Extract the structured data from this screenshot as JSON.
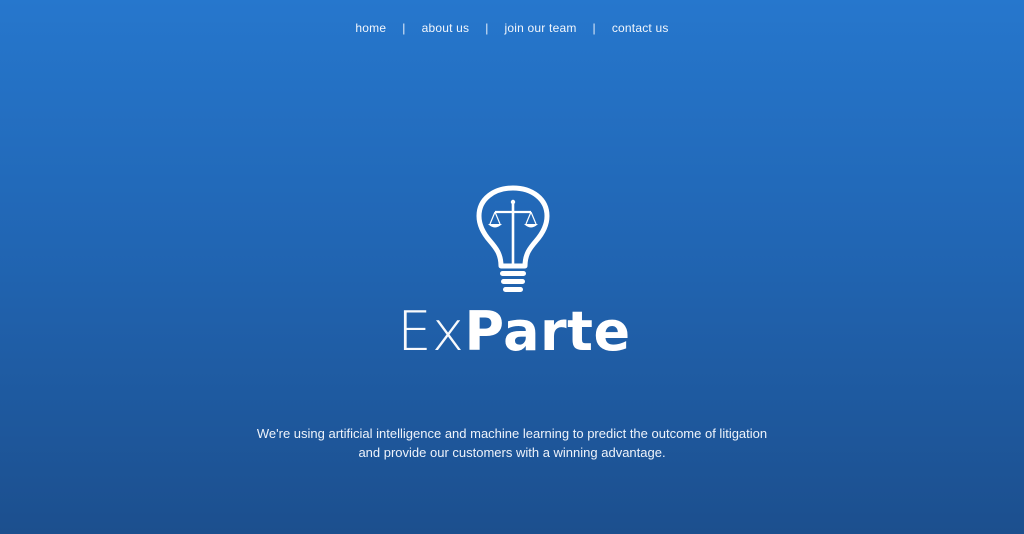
{
  "nav": {
    "items": [
      {
        "label": "home"
      },
      {
        "label": "about us"
      },
      {
        "label": "join our team"
      },
      {
        "label": "contact us"
      }
    ],
    "separator": "|"
  },
  "logo": {
    "icon": "lightbulb-scales-icon",
    "text_light": "Ex",
    "text_bold": "Parte"
  },
  "tagline": {
    "line1": "We're using artificial intelligence and machine learning to predict the outcome of litigation",
    "line2": "and provide our customers with a winning advantage."
  },
  "colors": {
    "background_top": "#2677cd",
    "background_bottom": "#1c4f8e",
    "text": "#ffffff"
  }
}
